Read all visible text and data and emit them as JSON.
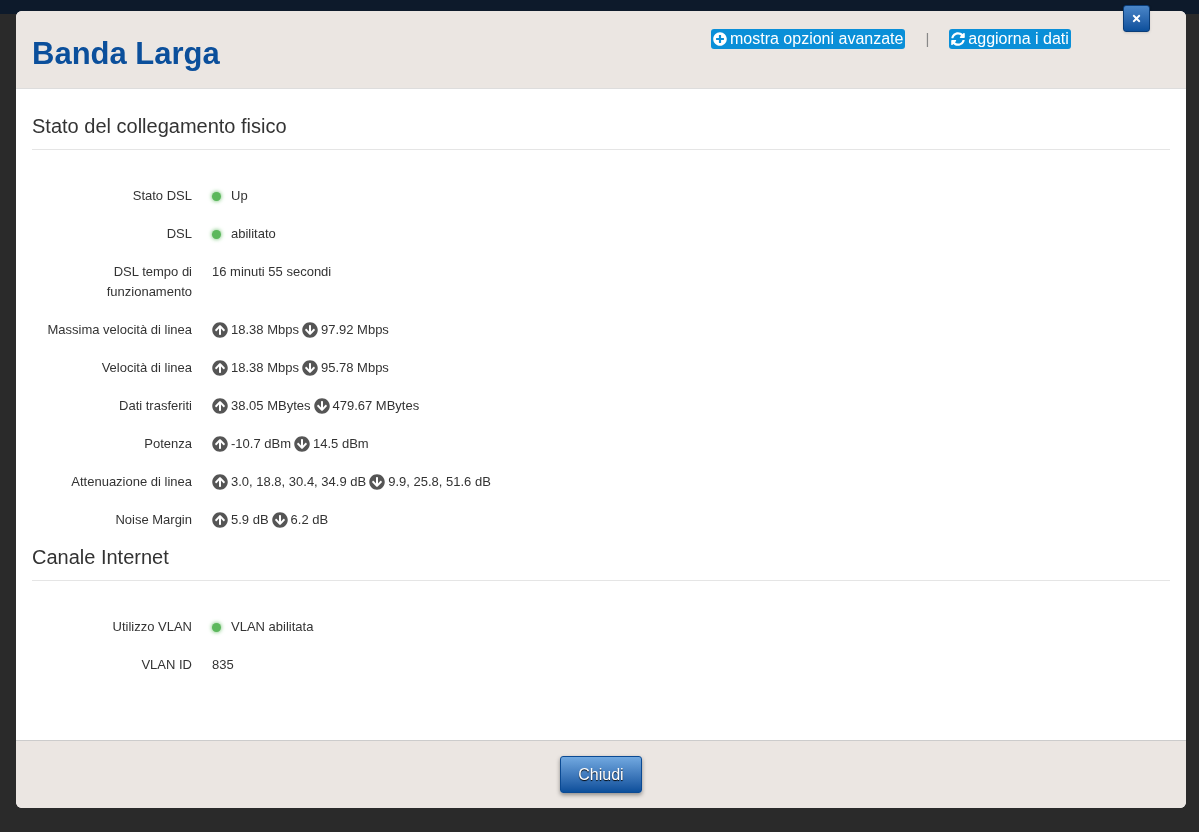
{
  "modal": {
    "title": "Banda Larga",
    "links": [
      {
        "kind": "expand",
        "label": "mostra opzioni avanzate"
      },
      {
        "kind": "refresh",
        "label": "aggiorna i dati"
      }
    ],
    "separator": "|"
  },
  "sections": [
    {
      "title": "Stato del collegamento fisico",
      "rows": [
        {
          "kind": "status",
          "label": "Stato DSL",
          "value": "Up",
          "color": "#5cb85c"
        },
        {
          "kind": "status",
          "label": "DSL",
          "value": "abilitato",
          "color": "#5cb85c"
        },
        {
          "kind": "text",
          "label": "DSL tempo di funzionamento",
          "value": "16 minuti 55 secondi"
        },
        {
          "kind": "updown",
          "label": "Massima velocità di linea",
          "up": "18.38 Mbps",
          "down": "97.92 Mbps"
        },
        {
          "kind": "updown",
          "label": "Velocità di linea",
          "up": "18.38 Mbps",
          "down": "95.78 Mbps"
        },
        {
          "kind": "updown",
          "label": "Dati trasferiti",
          "up": "38.05 MBytes",
          "down": "479.67 MBytes"
        },
        {
          "kind": "updown",
          "label": "Potenza",
          "up": "-10.7 dBm",
          "down": "14.5 dBm"
        },
        {
          "kind": "updown",
          "label": "Attenuazione di linea",
          "up": "3.0, 18.8, 30.4, 34.9 dB",
          "down": "9.9, 25.8, 51.6 dB"
        },
        {
          "kind": "updown",
          "label": "Noise Margin",
          "up": "5.9 dB",
          "down": "6.2 dB"
        }
      ]
    },
    {
      "title": "Canale Internet",
      "rows": [
        {
          "kind": "status",
          "label": "Utilizzo VLAN",
          "value": "VLAN abilitata",
          "color": "#5cb85c"
        },
        {
          "kind": "text",
          "label": "VLAN ID",
          "value": "835"
        }
      ]
    }
  ],
  "footer": {
    "button": "Chiudi"
  }
}
